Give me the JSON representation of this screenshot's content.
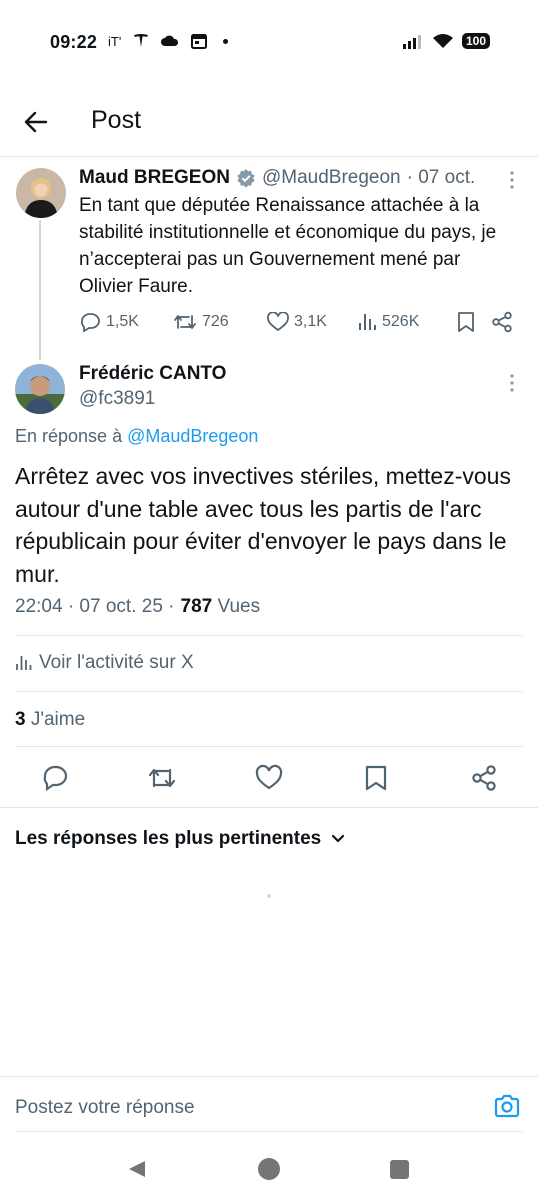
{
  "status_bar": {
    "time": "09:22",
    "left_icons": [
      "it-icon",
      "tesla-icon",
      "cloud-icon",
      "calendar-icon",
      "dot-icon"
    ],
    "battery": "100",
    "operator_glyph": "iT'"
  },
  "header": {
    "title": "Post"
  },
  "parent_tweet": {
    "name": "Maud BREGEON",
    "handle": "@MaudBregeon",
    "date": "· 07 oct.",
    "verified": true,
    "text": "En tant que députée Renaissance attachée à la stabilité institutionnelle et économique du pays, je n’accepterai pas un Gouvernement mené par Olivier Faure.",
    "replies": "1,5K",
    "reposts": "726",
    "likes": "3,1K",
    "views": "526K"
  },
  "main_tweet": {
    "name": "Frédéric CANTO",
    "handle": "@fc3891",
    "reply_prefix": "En réponse à",
    "reply_mention": "@MaudBregeon",
    "text": "Arrêtez avec vos invectives stériles, mettez-vous autour d'une table avec tous les partis de l'arc républicain pour éviter d'envoyer le pays dans le mur.",
    "time": "22:04 · 07 oct. 25 ·",
    "views_count": "787",
    "views_label": "Vues",
    "activity_label": "Voir l'activité sur X",
    "likes_count": "3",
    "likes_label": "J'aime"
  },
  "replies_sort": {
    "label": "Les réponses les plus pertinentes"
  },
  "composer": {
    "placeholder": "Postez votre réponse"
  },
  "colors": {
    "accent": "#1d9bf0",
    "text": "#0f1419",
    "muted": "#536471",
    "divider": "#e3e6ea"
  }
}
